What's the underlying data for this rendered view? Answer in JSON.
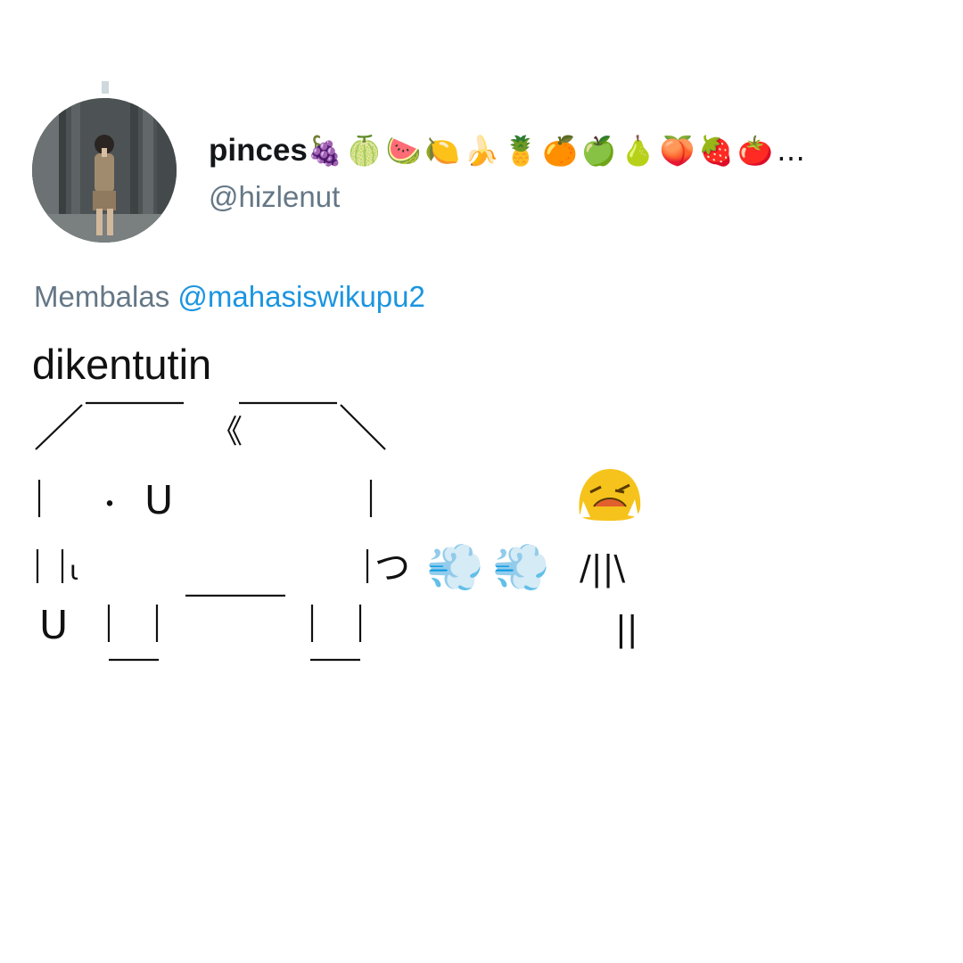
{
  "tweet": {
    "author": {
      "name": "pinces",
      "name_emoji": "🍇🍈🍉🍋🍌🍍🍊🍏🍐🍑🍓🍅…",
      "handle": "@hizlenut"
    },
    "reply": {
      "prefix": "Membalas",
      "mention": "@mahasiswikupu2"
    },
    "text": "dikentutin",
    "ascii_art": {
      "row1_left": "／￣￣￣",
      "row1_mid": "《￣￣￣＼",
      "row2_left": "|　・Ｕ",
      "row2_right": "|",
      "row3_left": "| |ι",
      "row3_right": "|つ",
      "row4_left": "U",
      "face_emoji": "😫",
      "figure_arms": "/||\\",
      "figure_legs": "||",
      "puff_emoji": "💨"
    }
  }
}
